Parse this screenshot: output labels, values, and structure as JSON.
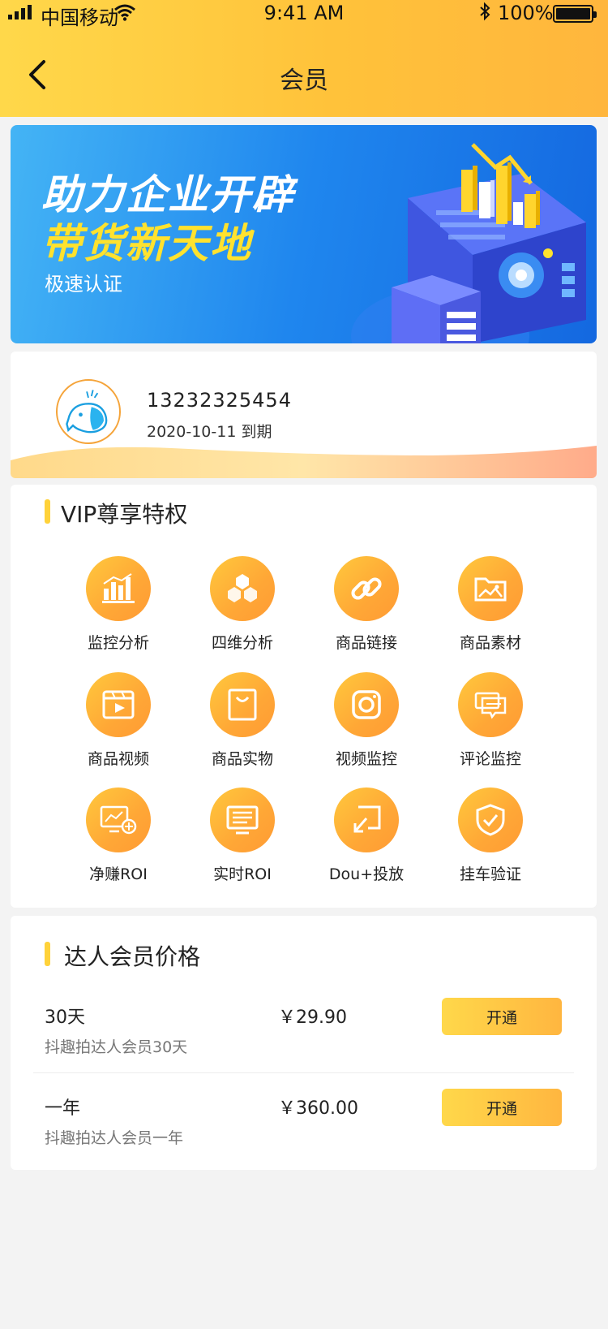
{
  "status_bar": {
    "carrier": "中国移动",
    "time": "9:41 AM",
    "battery": "100%"
  },
  "header": {
    "title": "会员"
  },
  "banner": {
    "line1": "助力企业开辟",
    "line2": "带货新天地",
    "line3": "极速认证"
  },
  "user": {
    "phone": "13232325454",
    "expire": "2020-10-11 到期"
  },
  "vip": {
    "title": "VIP尊享特权",
    "features": [
      {
        "label": "监控分析",
        "icon": "bar-chart-icon"
      },
      {
        "label": "四维分析",
        "icon": "hexagon-cluster-icon"
      },
      {
        "label": "商品链接",
        "icon": "link-icon"
      },
      {
        "label": "商品素材",
        "icon": "image-folder-icon"
      },
      {
        "label": "商品视频",
        "icon": "video-icon"
      },
      {
        "label": "商品实物",
        "icon": "shopping-bag-icon"
      },
      {
        "label": "视频监控",
        "icon": "camera-icon"
      },
      {
        "label": "评论监控",
        "icon": "comment-icon"
      },
      {
        "label": "净赚ROI",
        "icon": "monitor-chart-icon"
      },
      {
        "label": "实时ROI",
        "icon": "screen-list-icon"
      },
      {
        "label": "Dou+投放",
        "icon": "arrow-box-icon"
      },
      {
        "label": "挂车验证",
        "icon": "shield-check-icon"
      }
    ]
  },
  "pricing": {
    "title": "达人会员价格",
    "plans": [
      {
        "name": "30天",
        "price": "￥29.90",
        "desc": "抖趣拍达人会员30天",
        "button": "开通"
      },
      {
        "name": "一年",
        "price": "￥360.00",
        "desc": "抖趣拍达人会员一年",
        "button": "开通"
      }
    ]
  },
  "colors": {
    "accent": "#ffc23a",
    "icon_gradient_start": "#ffc83d",
    "icon_gradient_end": "#ff9b34",
    "banner_blue": "#1f86ee"
  }
}
